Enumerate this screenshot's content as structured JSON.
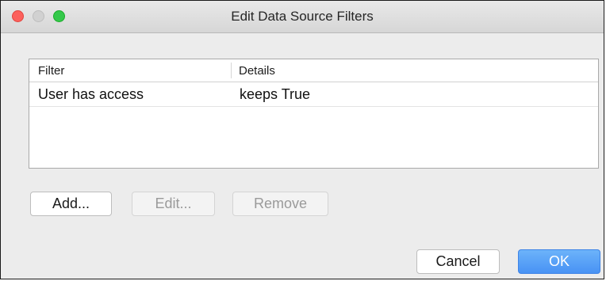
{
  "window": {
    "title": "Edit Data Source Filters"
  },
  "table": {
    "columns": [
      "Filter",
      "Details"
    ],
    "rows": [
      [
        "User has access",
        "keeps True"
      ]
    ]
  },
  "buttons": {
    "add": "Add...",
    "edit": "Edit...",
    "remove": "Remove",
    "cancel": "Cancel",
    "ok": "OK"
  },
  "button_states": {
    "edit_enabled": false,
    "remove_enabled": false,
    "ok_is_default": true
  },
  "colors": {
    "close": "#fc605c",
    "minimize_disabled": "#d1d1d1",
    "zoom": "#34c84a",
    "default_button": "#4892f4"
  },
  "icons": {
    "close": "traffic-light-close",
    "minimize": "traffic-light-minimize",
    "zoom": "traffic-light-zoom"
  }
}
